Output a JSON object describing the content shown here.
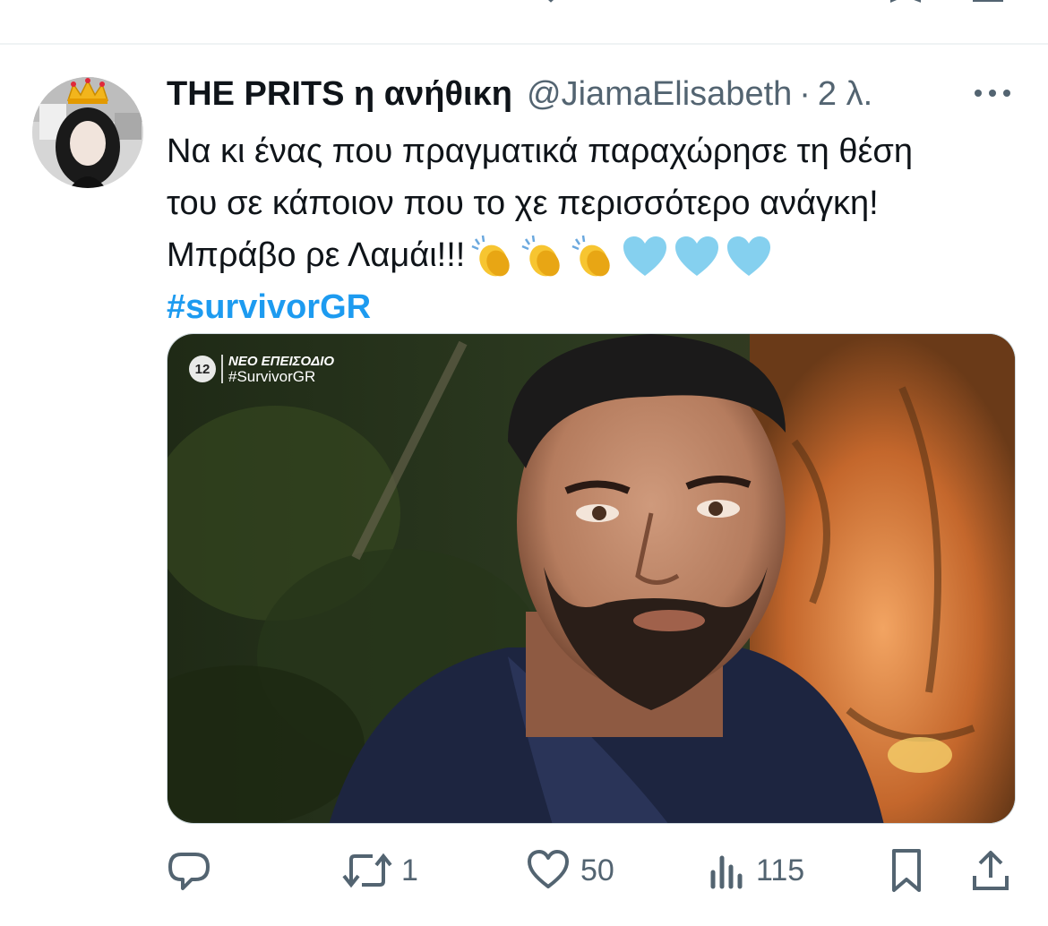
{
  "tweet": {
    "author_name": "THE PRITS η ανήθικη",
    "author_handle": "@JiamaElisabeth",
    "separator": "·",
    "time": "2 λ.",
    "text_lines": [
      "Να κι ένας που πραγματικά παραχώρησε τη θέση",
      "του σε κάποιον που το χε περισσότερο ανάγκη!",
      "Μπράβο ρε Λαμάι!!!"
    ],
    "emojis": [
      "clapping-hands",
      "clapping-hands",
      "clapping-hands",
      "light-blue-heart",
      "light-blue-heart",
      "light-blue-heart"
    ],
    "hashtag": "#survivorGR",
    "media": {
      "channel_number": "12",
      "overlay_line1": "ΝΕΟ ΕΠΕΙΣΟΔΙΟ",
      "overlay_line2": "#SurvivorGR"
    },
    "actions": {
      "reply_icon": "reply-icon",
      "retweet_icon": "retweet-icon",
      "retweet_count": "1",
      "like_icon": "heart-icon",
      "like_count": "50",
      "views_icon": "views-icon",
      "views_count": "115",
      "bookmark_icon": "bookmark-icon",
      "share_icon": "share-icon"
    }
  },
  "colors": {
    "text_primary": "#0f1419",
    "text_secondary": "#536471",
    "hashtag": "#1d9bf0",
    "divider": "#eff3f4"
  }
}
